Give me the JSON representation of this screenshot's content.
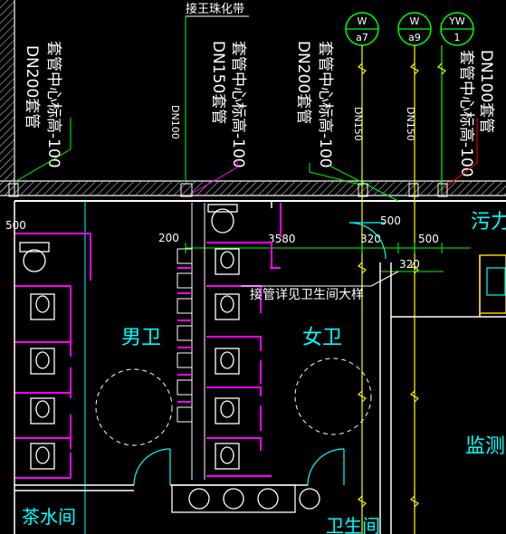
{
  "drawing": {
    "top_label": "接王珠化带",
    "risers": [
      {
        "text": "DN200套管",
        "color": "#ffffff"
      },
      {
        "text": "套管中心标高-100",
        "color": "#ffffff"
      },
      {
        "text": "DN150套管",
        "color": "#ffffff"
      },
      {
        "text": "套管中心标高-100",
        "color": "#ffffff"
      },
      {
        "text": "DN100",
        "color": "#ffffff"
      },
      {
        "text": "DN200套管",
        "color": "#ffffff"
      },
      {
        "text": "套管中心标高-100",
        "color": "#ffffff"
      },
      {
        "text": "DN150",
        "color": "#ffffff"
      },
      {
        "text": "DN150",
        "color": "#ffffff"
      },
      {
        "text": "套管中心标高-100",
        "color": "#ffffff"
      },
      {
        "text": "DN100套管",
        "color": "#ffffff"
      }
    ],
    "pipe_tags": [
      {
        "top": "W",
        "bottom": "a7"
      },
      {
        "top": "W",
        "bottom": "a9"
      },
      {
        "top": "YW",
        "bottom": "1"
      }
    ],
    "dimensions": [
      "500",
      "200",
      "3580",
      "320",
      "500",
      "320",
      "500"
    ],
    "rooms": {
      "male": "男卫",
      "female": "女卫",
      "tea": "茶水间",
      "monitor": "监测",
      "waste": "污力",
      "bottom_partial": "卫生间"
    },
    "note": "接管详见卫生间大样",
    "colors": {
      "background": "#000000",
      "wall": "#c8c8c8",
      "partition": "#ff00ff",
      "fixture": "#ffffff",
      "pipe_green": "#00ff00",
      "pipe_yellow": "#ffff00",
      "pipe_red": "#ff0000",
      "accent_cyan": "#00ffff"
    }
  }
}
